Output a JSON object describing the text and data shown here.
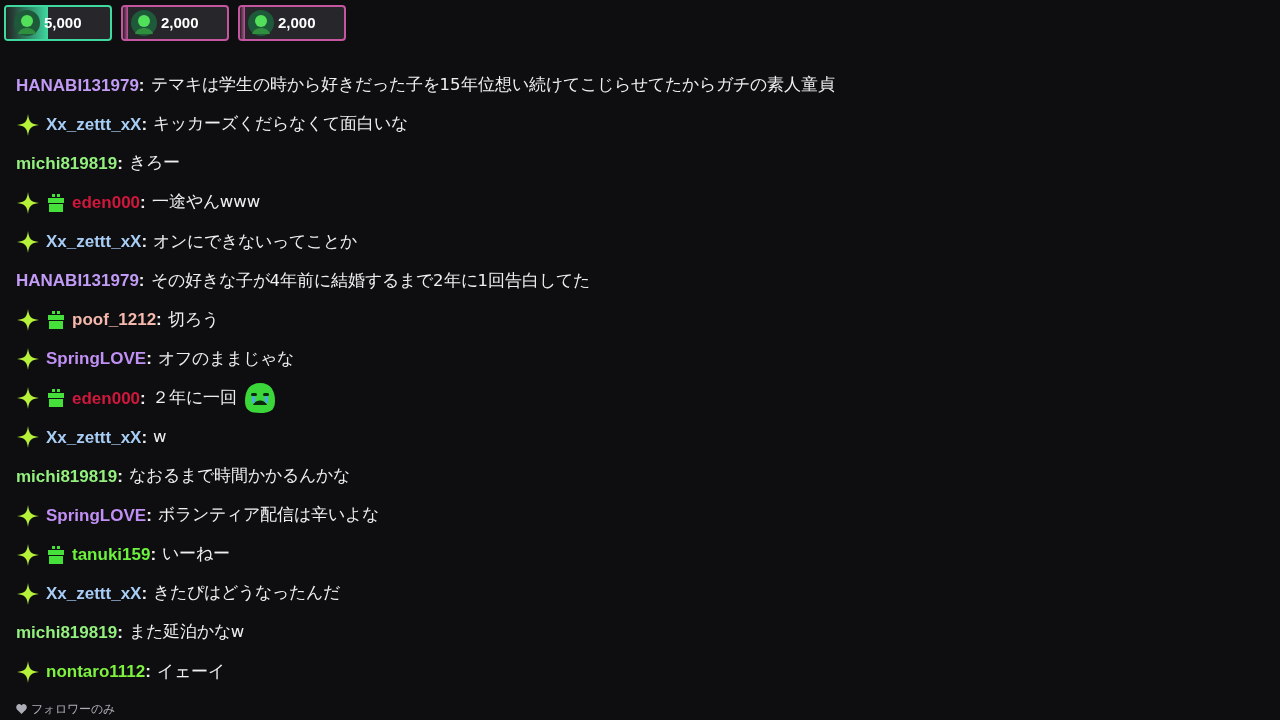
{
  "leaderboard": [
    {
      "amount": "5,000",
      "level": 0.4,
      "color": "#3fd9a0"
    },
    {
      "amount": "2,000",
      "level": 0.05,
      "color": "#c4559f"
    },
    {
      "amount": "2,000",
      "level": 0.05,
      "color": "#c4559f"
    }
  ],
  "chat": {
    "separator": ":",
    "messages": [
      {
        "sparkle": false,
        "gift": false,
        "user": "HANABI131979",
        "color": "#c29bf6",
        "text": "テマキは学生の時から好きだった子を15年位想い続けてこじらせてたからガチの素人童貞",
        "emote": false
      },
      {
        "sparkle": true,
        "gift": false,
        "user": "Xx_zettt_xX",
        "color": "#a8cdf5",
        "text": "キッカーズくだらなくて面白いな",
        "emote": false
      },
      {
        "sparkle": false,
        "gift": false,
        "user": "michi819819",
        "color": "#93ef7e",
        "text": "きろー",
        "emote": false
      },
      {
        "sparkle": true,
        "gift": true,
        "user": "eden000",
        "color": "#d0173c",
        "text": "一途やんwww",
        "emote": false
      },
      {
        "sparkle": true,
        "gift": false,
        "user": "Xx_zettt_xX",
        "color": "#a8cdf5",
        "text": "オンにできないってことか",
        "emote": false
      },
      {
        "sparkle": false,
        "gift": false,
        "user": "HANABI131979",
        "color": "#c29bf6",
        "text": "その好きな子が4年前に結婚するまで2年に1回告白してた",
        "emote": false
      },
      {
        "sparkle": true,
        "gift": true,
        "user": "poof_1212",
        "color": "#f5b8ad",
        "text": "切ろう",
        "emote": false
      },
      {
        "sparkle": true,
        "gift": false,
        "user": "SpringLOVE",
        "color": "#c190f5",
        "text": "オフのままじゃな",
        "emote": false
      },
      {
        "sparkle": true,
        "gift": true,
        "user": "eden000",
        "color": "#d0173c",
        "text": "２年に一回",
        "emote": true
      },
      {
        "sparkle": true,
        "gift": false,
        "user": "Xx_zettt_xX",
        "color": "#a8cdf5",
        "text": "w",
        "emote": false
      },
      {
        "sparkle": false,
        "gift": false,
        "user": "michi819819",
        "color": "#93ef7e",
        "text": "なおるまで時間かかるんかな",
        "emote": false
      },
      {
        "sparkle": true,
        "gift": false,
        "user": "SpringLOVE",
        "color": "#c190f5",
        "text": "ボランティア配信は辛いよな",
        "emote": false
      },
      {
        "sparkle": true,
        "gift": true,
        "user": "tanuki159",
        "color": "#6cf23c",
        "text": "いーねー",
        "emote": false
      },
      {
        "sparkle": true,
        "gift": false,
        "user": "Xx_zettt_xX",
        "color": "#a8cdf5",
        "text": "きたぴはどうなったんだ",
        "emote": false
      },
      {
        "sparkle": false,
        "gift": false,
        "user": "michi819819",
        "color": "#93ef7e",
        "text": "また延泊かなw",
        "emote": false
      },
      {
        "sparkle": true,
        "gift": false,
        "user": "nontaro1112",
        "color": "#7ef23f",
        "text": "イェーイ",
        "emote": false
      }
    ]
  },
  "footer": {
    "mode": "フォロワーのみ"
  }
}
